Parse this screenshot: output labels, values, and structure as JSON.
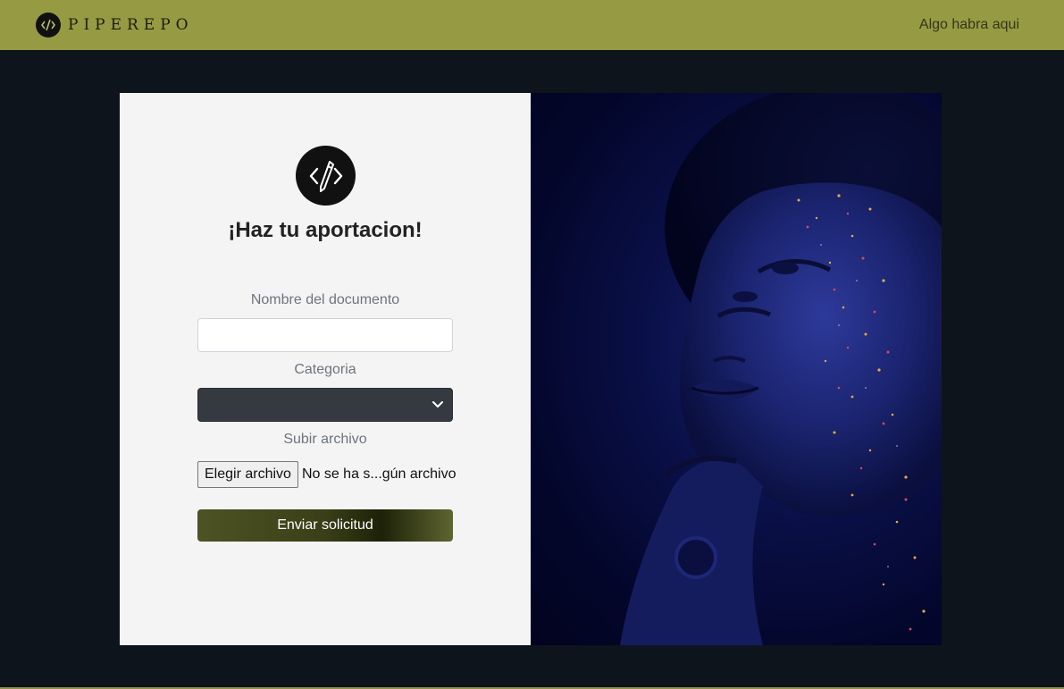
{
  "navbar": {
    "brand_text": "PIPEREPO",
    "nav_link": "Algo habra aqui",
    "background_color": "#969a42"
  },
  "form": {
    "icon": "code-pencil-icon",
    "title": "¡Haz tu aportacion!",
    "document_name_label": "Nombre del documento",
    "document_name_value": "",
    "category_label": "Categoria",
    "category_selected": "",
    "upload_label": "Subir archivo",
    "file_button_label": "Elegir archivo",
    "file_status": "No se ha s...gún archivo",
    "submit_label": "Enviar solicitud"
  },
  "image": {
    "description_icon": "portrait-photo"
  },
  "colors": {
    "page_background": "#0e141b",
    "form_background": "#f4f4f4",
    "select_background": "#343a40",
    "submit_gradient_dark": "#1d2208",
    "submit_gradient_olive": "#5f6530"
  }
}
